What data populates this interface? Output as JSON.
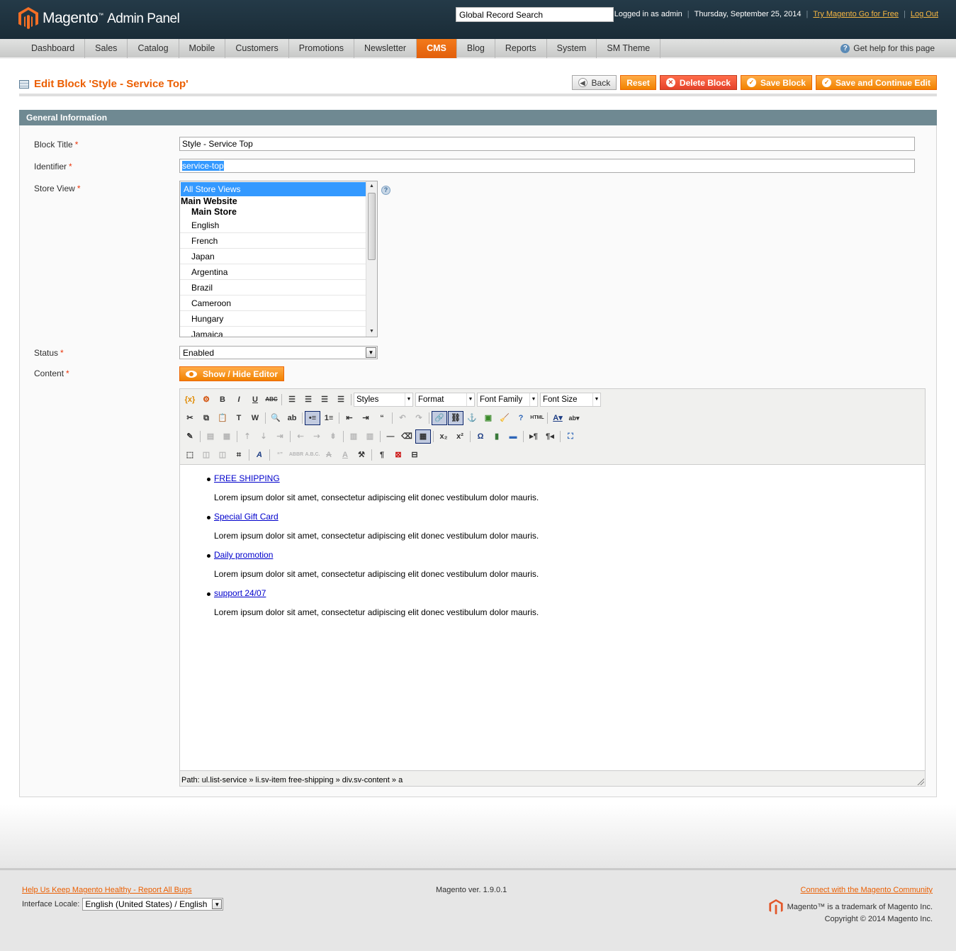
{
  "header": {
    "brand": "Magento",
    "brand_sub": "Admin Panel",
    "search_value": "Global Record Search",
    "logged_in": "Logged in as admin",
    "date": "Thursday, September 25, 2014",
    "try_link": "Try Magento Go for Free",
    "logout": "Log Out"
  },
  "nav": {
    "items": [
      "Dashboard",
      "Sales",
      "Catalog",
      "Mobile",
      "Customers",
      "Promotions",
      "Newsletter",
      "CMS",
      "Blog",
      "Reports",
      "System",
      "SM Theme"
    ],
    "active": "CMS",
    "help": "Get help for this page"
  },
  "page": {
    "title": "Edit Block 'Style - Service Top'",
    "buttons": {
      "back": "Back",
      "reset": "Reset",
      "delete": "Delete Block",
      "save": "Save Block",
      "save_continue": "Save and Continue Edit"
    }
  },
  "form": {
    "section": "General Information",
    "block_title_label": "Block Title",
    "block_title_value": "Style - Service Top",
    "identifier_label": "Identifier",
    "identifier_value": "service-top",
    "store_view_label": "Store View",
    "store_view": {
      "selected": "All Store Views",
      "website": "Main Website",
      "store": "Main Store",
      "options": [
        "English",
        "French",
        "Japan",
        "Argentina",
        "Brazil",
        "Cameroon",
        "Hungary",
        "Jamaica"
      ]
    },
    "status_label": "Status",
    "status_value": "Enabled",
    "content_label": "Content",
    "show_hide": "Show / Hide Editor",
    "required_mark": "*"
  },
  "editor": {
    "dropdowns": {
      "styles": "Styles",
      "format": "Format",
      "font_family": "Font Family",
      "font_size": "Font Size"
    },
    "items": [
      {
        "link": "FREE SHIPPING",
        "text": "Lorem ipsum dolor sit amet, consectetur adipiscing elit donec vestibulum dolor mauris."
      },
      {
        "link": "Special Gift Card",
        "text": "Lorem ipsum dolor sit amet, consectetur adipiscing elit donec vestibulum dolor mauris."
      },
      {
        "link": "Daily promotion",
        "text": "Lorem ipsum dolor sit amet, consectetur adipiscing elit donec vestibulum dolor mauris."
      },
      {
        "link": "support 24/07",
        "text": "Lorem ipsum dolor sit amet, consectetur adipiscing elit donec vestibulum dolor mauris."
      }
    ],
    "path": "Path: ul.list-service » li.sv-item free-shipping » div.sv-content » a"
  },
  "footer": {
    "bugs_link": "Help Us Keep Magento Healthy - Report All Bugs",
    "locale_label": "Interface Locale:",
    "locale_value": "English (United States) / English",
    "version": "Magento ver. 1.9.0.1",
    "community_link": "Connect with the Magento Community",
    "trademark": "Magento™ is a trademark of Magento Inc.",
    "copyright": "Copyright © 2014 Magento Inc."
  },
  "colors": {
    "accent": "#eb5e00",
    "header_bg": "#1f3442",
    "section_bg": "#6f8992"
  }
}
